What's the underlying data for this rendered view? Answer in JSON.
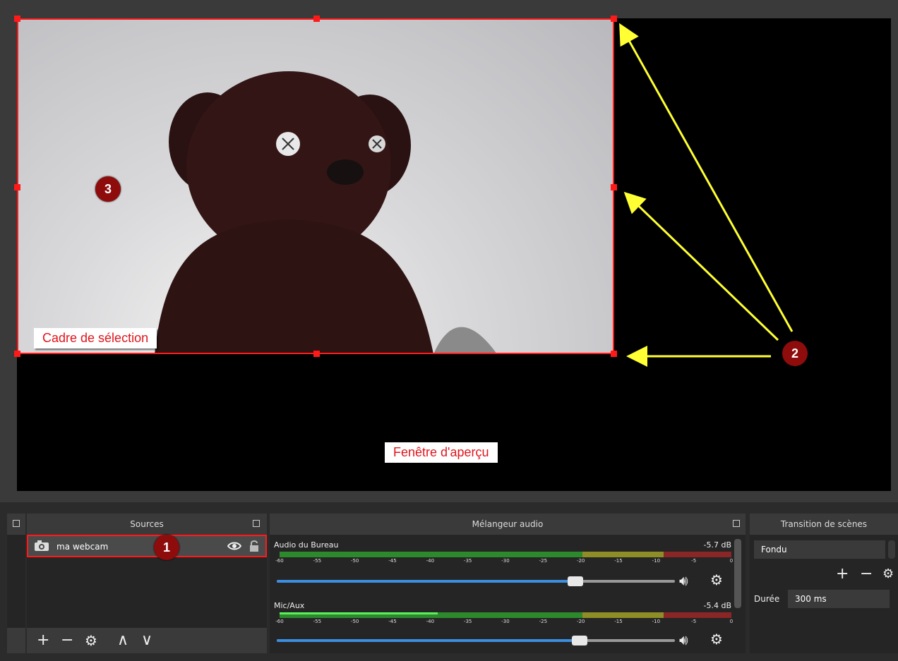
{
  "preview": {
    "selection_label": "Cadre de sélection",
    "window_label": "Fenêtre d'aperçu",
    "callouts": [
      "1",
      "2",
      "3"
    ]
  },
  "sources": {
    "title": "Sources",
    "items": [
      {
        "name": "ma webcam",
        "icon": "camera-icon"
      }
    ],
    "toolbar": {
      "add": "+",
      "remove": "−",
      "settings": "⚙",
      "up": "∧",
      "down": "∨"
    }
  },
  "mixer": {
    "title": "Mélangeur audio",
    "ticks": [
      "-60",
      "-55",
      "-50",
      "-45",
      "-40",
      "-35",
      "-30",
      "-25",
      "-20",
      "-15",
      "-10",
      "-5",
      "0"
    ],
    "tracks": [
      {
        "name": "Audio du Bureau",
        "db": "-5.7 dB",
        "level": 0.0,
        "volume": 0.75
      },
      {
        "name": "Mic/Aux",
        "db": "-5.4 dB",
        "level": 0.35,
        "volume": 0.76
      }
    ]
  },
  "transitions": {
    "title": "Transition de scènes",
    "selected": "Fondu",
    "duration_label": "Durée",
    "duration_value": "300 ms"
  },
  "colors": {
    "selection": "#ff1a1a",
    "callout": "#8e0c0c",
    "arrow": "#ffff33",
    "meter_green": "#2c8a2c",
    "volume_blue": "#3b8ee0"
  }
}
